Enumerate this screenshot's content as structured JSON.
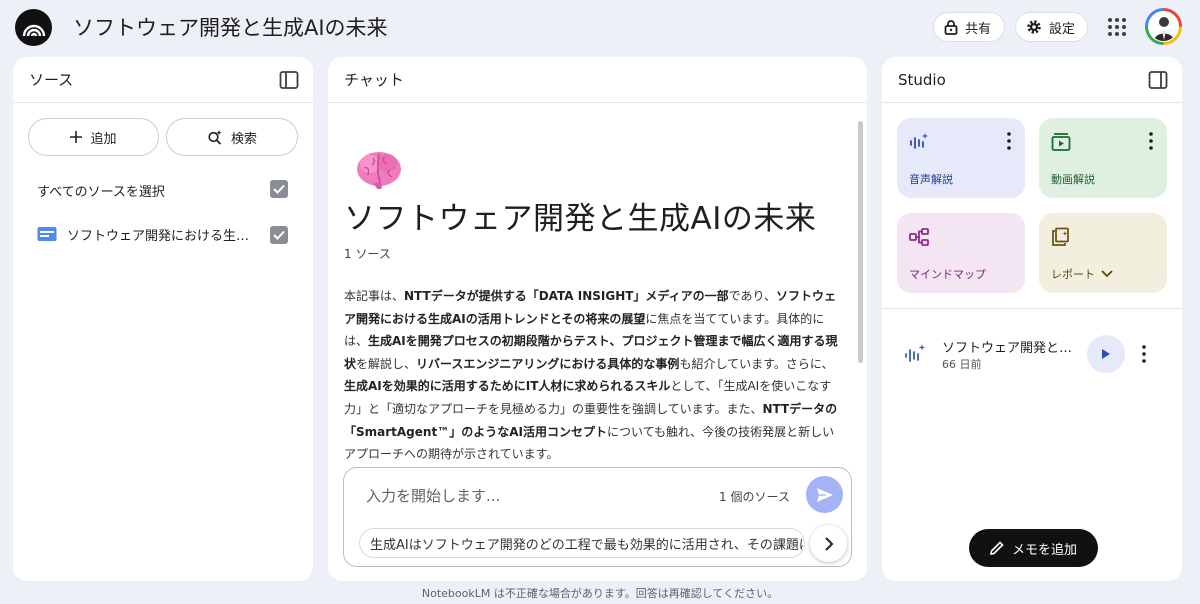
{
  "header": {
    "title": "ソフトウェア開発と生成AIの未来",
    "share_label": "共有",
    "settings_label": "設定"
  },
  "sources_panel": {
    "title": "ソース",
    "add_label": "追加",
    "search_label": "検索",
    "select_all_label": "すべてのソースを選択",
    "items": [
      {
        "label": "ソフトウェア開発における生成AIの活用トレンド",
        "checked": true
      }
    ]
  },
  "chat_panel": {
    "title": "チャット",
    "notebook_title": "ソフトウェア開発と生成AIの未来",
    "source_count": "1 ソース",
    "summary_segments": [
      {
        "text": "本記事は、",
        "bold": false
      },
      {
        "text": "NTTデータが提供する「DATA INSIGHT」メディアの一部",
        "bold": true
      },
      {
        "text": "であり、",
        "bold": false
      },
      {
        "text": "ソフトウェア開発における生成AIの活用トレンドとその将来の展望",
        "bold": true
      },
      {
        "text": "に焦点を当てています。具体的には、",
        "bold": false
      },
      {
        "text": "生成AIを開発プロセスの初期段階からテスト、プロジェクト管理まで幅広く適用する現状",
        "bold": true
      },
      {
        "text": "を解説し、",
        "bold": false
      },
      {
        "text": "リバースエンジニアリングにおける具体的な事例",
        "bold": true
      },
      {
        "text": "も紹介しています。さらに、",
        "bold": false
      },
      {
        "text": "生成AIを効果的に活用するためにIT人材に求められるスキル",
        "bold": true
      },
      {
        "text": "として、「生成AIを使いこなす力」と「適切なアプローチを見極める力」の重要性を強調しています。また、",
        "bold": false
      },
      {
        "text": "NTTデータの「SmartAgent™」のようなAI活用コンセプト",
        "bold": true
      },
      {
        "text": "についても触れ、今後の技術発展と新しいアプローチへの期待が示されています。",
        "bold": false
      }
    ],
    "input_placeholder": "入力を開始します...",
    "input_source_count": "1 個のソース",
    "suggestion": "生成AIはソフトウェア開発のどの工程で最も効果的に活用され、その課題は"
  },
  "studio_panel": {
    "title": "Studio",
    "tiles": {
      "audio": "音声解説",
      "video": "動画解説",
      "mindmap": "マインドマップ",
      "report": "レポート"
    },
    "note": {
      "title": "ソフトウェア開発と…",
      "time": "66 日前"
    },
    "add_note_label": "メモを追加"
  },
  "footer": {
    "disclaimer": "NotebookLM は不正確な場合があります。回答は再確認してください。"
  },
  "colors": {
    "background": "#eef0f8",
    "send_button": "#a4b3f6",
    "audio_tile": "#e5e9f9",
    "video_tile": "#dff0e2",
    "mindmap_tile": "#f3e5f1",
    "report_tile": "#f2efdf"
  },
  "icons": [
    "notebooklm-logo-icon",
    "lock-icon",
    "gear-icon",
    "apps-grid-icon",
    "avatar",
    "panel-toggle-icon",
    "plus-icon",
    "search-sparkle-icon",
    "document-icon",
    "checkbox-checked-icon",
    "brain-emoji-icon",
    "send-icon",
    "chevron-right-icon",
    "audio-wave-icon",
    "video-icon",
    "mindmap-icon",
    "report-icon",
    "more-vert-icon",
    "play-icon",
    "pencil-icon",
    "chevron-down-icon"
  ]
}
